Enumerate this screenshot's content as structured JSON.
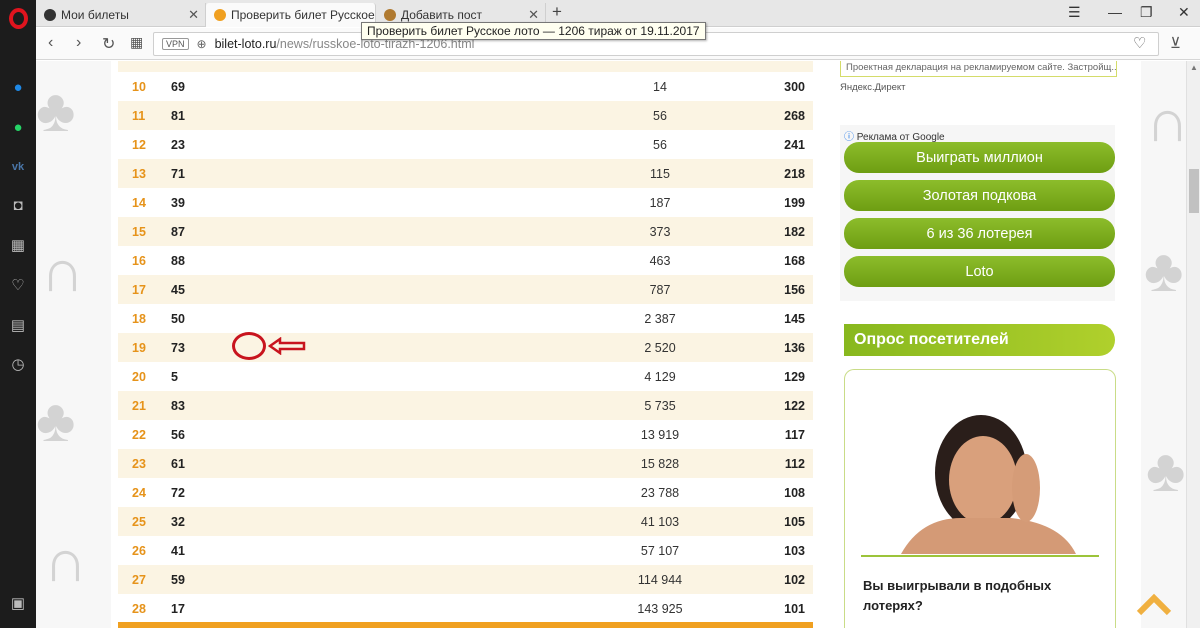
{
  "browser": {
    "tabs": [
      {
        "label": "Мои билеты"
      },
      {
        "label": "Проверить билет Русское"
      },
      {
        "label": "Добавить пост"
      }
    ],
    "url_host": "bilet-loto.ru",
    "url_path": "/news/russkoe-loto-tirazh-1206.html",
    "vpn_label": "VPN",
    "tooltip": "Проверить билет Русское лото — 1206 тираж от 19.11.2017"
  },
  "table": {
    "rows": [
      {
        "step": "10",
        "number": "69",
        "winners": "14",
        "prize": "300"
      },
      {
        "step": "11",
        "number": "81",
        "winners": "56",
        "prize": "268"
      },
      {
        "step": "12",
        "number": "23",
        "winners": "56",
        "prize": "241"
      },
      {
        "step": "13",
        "number": "71",
        "winners": "115",
        "prize": "218"
      },
      {
        "step": "14",
        "number": "39",
        "winners": "187",
        "prize": "199"
      },
      {
        "step": "15",
        "number": "87",
        "winners": "373",
        "prize": "182"
      },
      {
        "step": "16",
        "number": "88",
        "winners": "463",
        "prize": "168"
      },
      {
        "step": "17",
        "number": "45",
        "winners": "787",
        "prize": "156"
      },
      {
        "step": "18",
        "number": "50",
        "winners": "2 387",
        "prize": "145"
      },
      {
        "step": "19",
        "number": "73",
        "winners": "2 520",
        "prize": "136"
      },
      {
        "step": "20",
        "number": "5",
        "winners": "4 129",
        "prize": "129"
      },
      {
        "step": "21",
        "number": "83",
        "winners": "5 735",
        "prize": "122"
      },
      {
        "step": "22",
        "number": "56",
        "winners": "13 919",
        "prize": "117"
      },
      {
        "step": "23",
        "number": "61",
        "winners": "15 828",
        "prize": "112"
      },
      {
        "step": "24",
        "number": "72",
        "winners": "23 788",
        "prize": "108"
      },
      {
        "step": "25",
        "number": "32",
        "winners": "41 103",
        "prize": "105"
      },
      {
        "step": "26",
        "number": "41",
        "winners": "57 107",
        "prize": "103"
      },
      {
        "step": "27",
        "number": "59",
        "winners": "114 944",
        "prize": "102"
      },
      {
        "step": "28",
        "number": "17",
        "winners": "143 925",
        "prize": "101"
      }
    ]
  },
  "sidebar_right": {
    "ad_text": "Проектная декларация на рекламируемом сайте. Застройщ...",
    "yandex_label": "Яндекс.Директ",
    "google_label": "Реклама от Google",
    "ad_buttons": [
      {
        "label": "Выиграть миллион"
      },
      {
        "label": "Золотая подкова"
      },
      {
        "label": "6 из 36 лотерея"
      },
      {
        "label": "Loto"
      }
    ],
    "poll_title": "Опрос посетителей",
    "poll_question": "Вы выигрывали в подобных лотерях?"
  },
  "colors": {
    "accent_orange": "#e6931a",
    "accent_green": "#7aa91a",
    "highlight_red": "#c8141e"
  }
}
